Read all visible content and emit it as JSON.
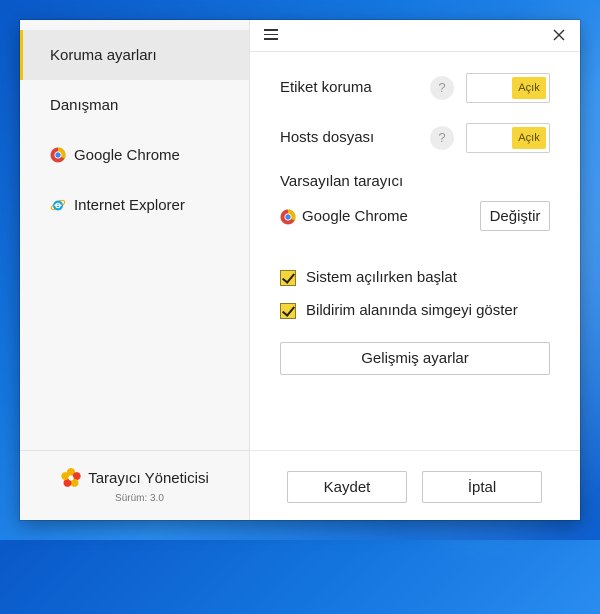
{
  "sidebar": {
    "items": [
      {
        "label": "Koruma ayarları",
        "icon": null,
        "active": true
      },
      {
        "label": "Danışman",
        "icon": null,
        "active": false
      },
      {
        "label": "Google Chrome",
        "icon": "chrome-icon",
        "active": false
      },
      {
        "label": "Internet Explorer",
        "icon": "ie-icon",
        "active": false
      }
    ],
    "brand_name": "Tarayıcı Yöneticisi",
    "version": "Sürüm: 3.0",
    "brand_icon": "yandex-flower-icon"
  },
  "settings": {
    "label_protection": "Etiket koruma",
    "label_protection_toggle": "Açık",
    "hosts_file": "Hosts dosyası",
    "hosts_file_toggle": "Açık",
    "help_glyph": "?",
    "default_browser_label": "Varsayılan tarayıcı",
    "default_browser_value": "Google Chrome",
    "change_button": "Değiştir",
    "start_on_boot": "Sistem açılırken başlat",
    "show_tray_icon": "Bildirim alanında simgeyi göster",
    "advanced_button": "Gelişmiş ayarlar"
  },
  "footer": {
    "save_button": "Kaydet",
    "cancel_button": "İptal"
  },
  "colors": {
    "accent": "#f6d53a",
    "desktop": "#1577e0"
  }
}
